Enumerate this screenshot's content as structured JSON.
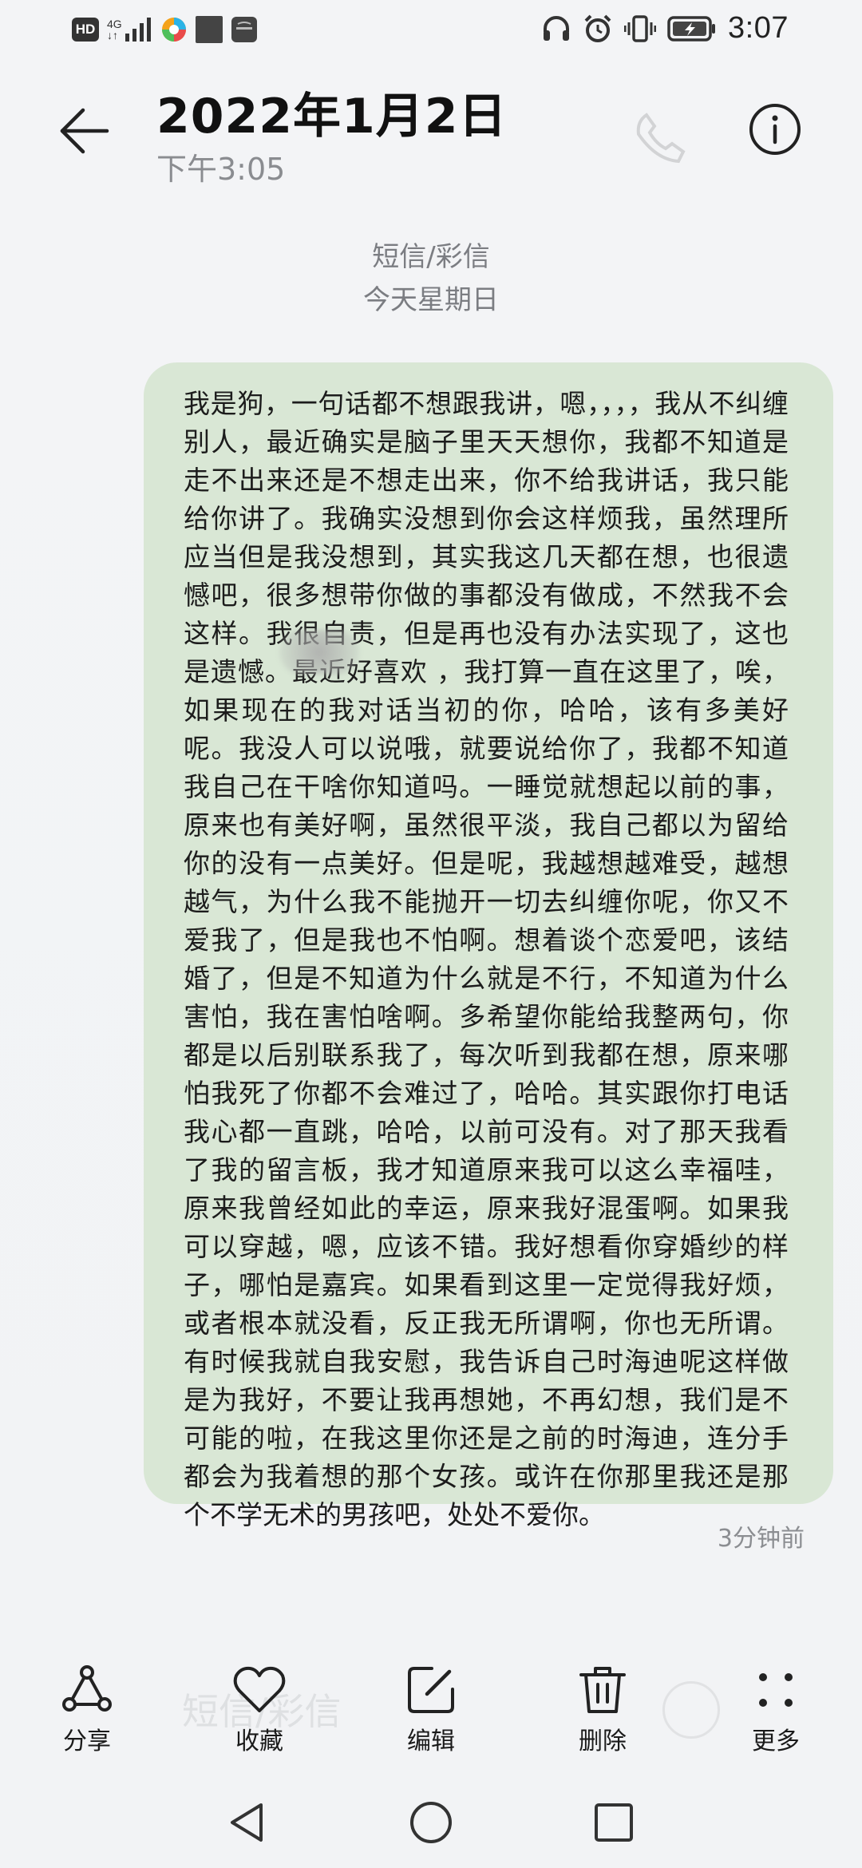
{
  "status_bar": {
    "hd": "HD",
    "network_top": "4G",
    "network_bottom": "↓↑",
    "time": "3:07"
  },
  "header": {
    "date": "2022年1月2日",
    "time": "下午3:05"
  },
  "meta": {
    "message_type": "短信/彩信",
    "day": "今天星期日"
  },
  "message": {
    "text": "我是狗，一句话都不想跟我讲，嗯，，，，我从不纠缠别人，最近确实是脑子里天天想你，我都不知道是走不出来还是不想走出来，你不给我讲话，我只能给你讲了。我确实没想到你会这样烦我，虽然理所应当但是我没想到，其实我这几天都在想，也很遗憾吧，很多想带你做的事都没有做成，不然我不会这样。我很自责，但是再也没有办法实现了，这也是遗憾。最近好喜欢 ，我打算一直在这里了，唉，如果现在的我对话当初的你，哈哈，该有多美好呢。我没人可以说哦，就要说给你了，我都不知道我自己在干啥你知道吗。一睡觉就想起以前的事，原来也有美好啊，虽然很平淡，我自己都以为留给你的没有一点美好。但是呢，我越想越难受，越想越气，为什么我不能抛开一切去纠缠你呢，你又不爱我了，但是我也不怕啊。想着谈个恋爱吧，该结婚了，但是不知道为什么就是不行，不知道为什么害怕，我在害怕啥啊。多希望你能给我整两句，你都是以后别联系我了，每次听到我都在想，原来哪怕我死了你都不会难过了，哈哈。其实跟你打电话我心都一直跳，哈哈，以前可没有。对了那天我看了我的留言板，我才知道原来我可以这么幸福哇，原来我曾经如此的幸运，原来我好混蛋啊。如果我可以穿越，嗯，应该不错。我好想看你穿婚纱的样子，哪怕是嘉宾。如果看到这里一定觉得我好烦，或者根本就没看，反正我无所谓啊，你也无所谓。有时候我就自我安慰，我告诉自己时海迪呢这样做是为我好，不要让我再想她，不再幻想，我们是不可能的啦，在我这里你还是之前的时海迪，连分手都会为我着想的那个女孩。或许在你那里我还是那个不学无术的男孩吧，处处不爱你。",
    "relative_time": "3分钟前"
  },
  "actions": {
    "share": "分享",
    "favorite": "收藏",
    "edit": "编辑",
    "delete": "删除",
    "more": "更多"
  },
  "input": {
    "placeholder": "短信/彩信"
  },
  "colors": {
    "bubble": "#d9e7d5",
    "background": "#f2f3f5",
    "secondary_text": "#8a8c90"
  }
}
